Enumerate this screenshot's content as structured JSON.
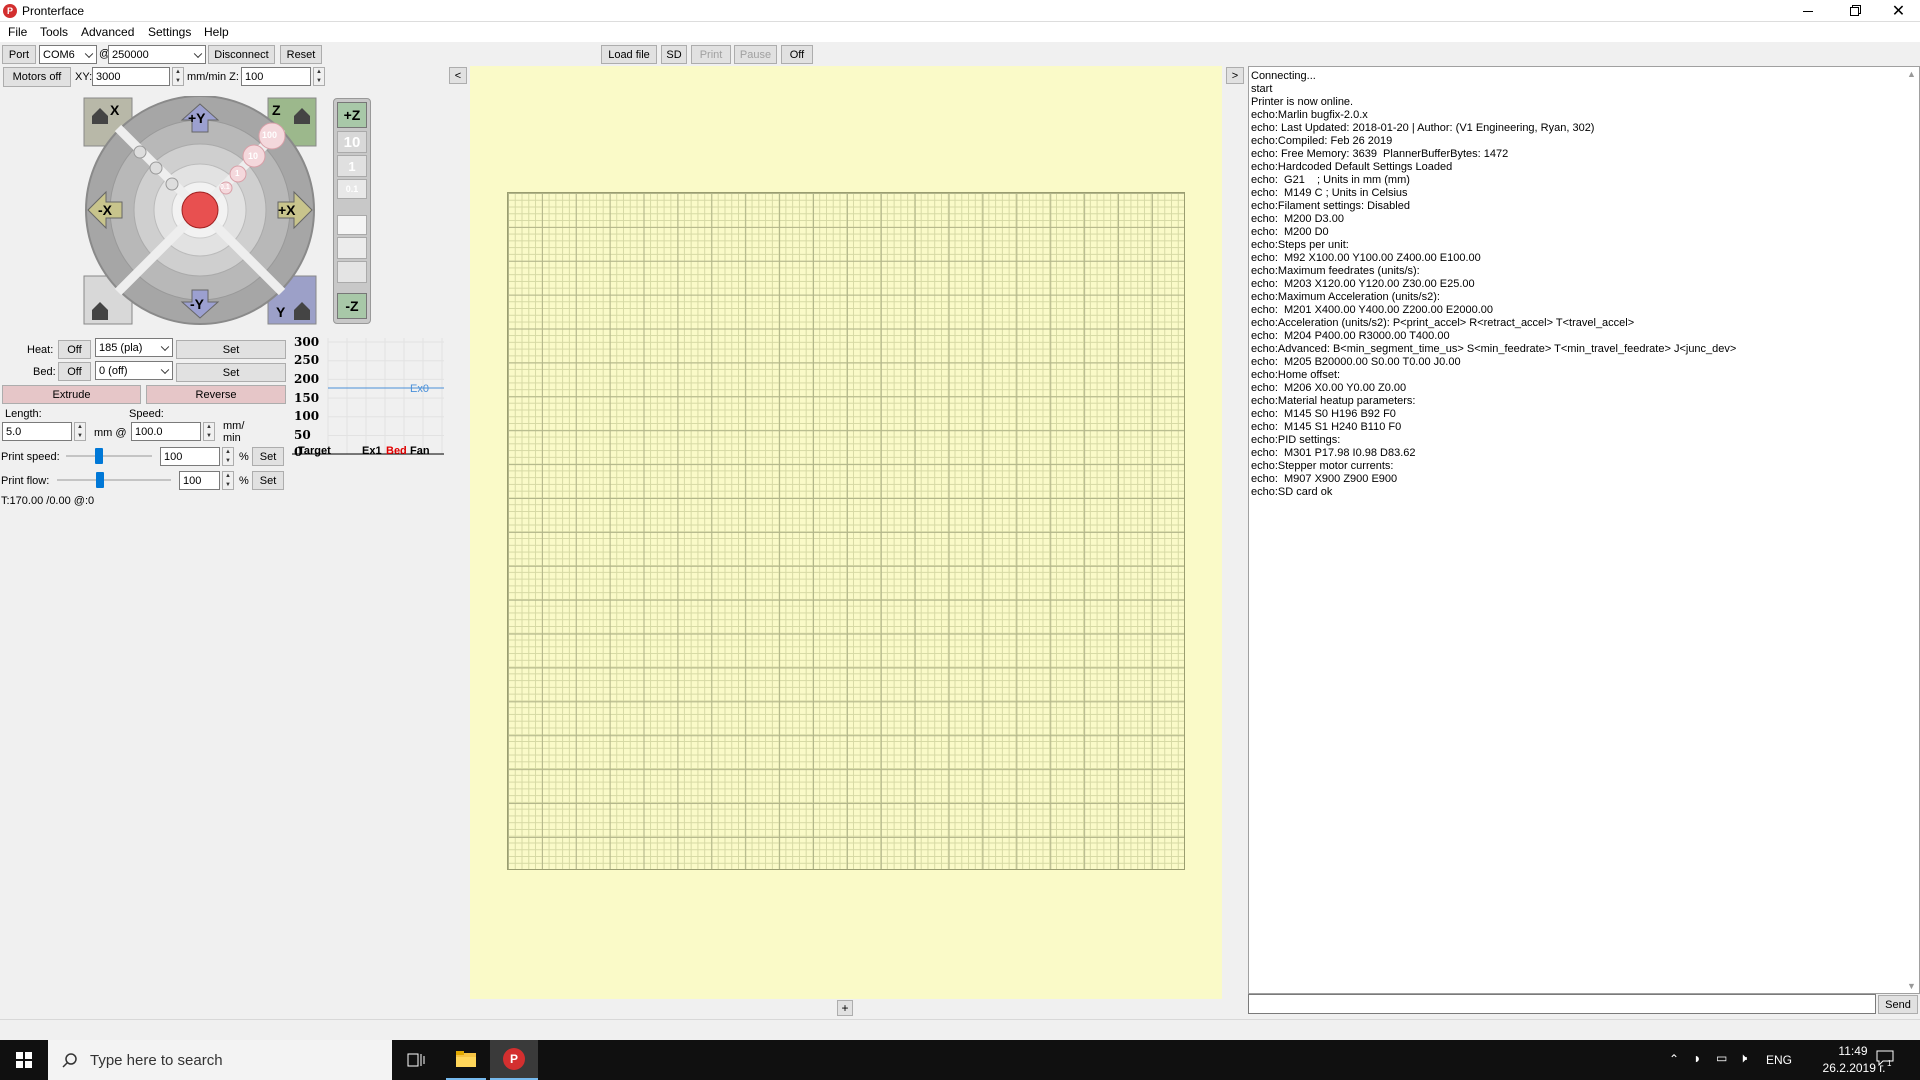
{
  "window": {
    "title": "Pronterface"
  },
  "menu": [
    "File",
    "Tools",
    "Advanced",
    "Settings",
    "Help"
  ],
  "toolbar": {
    "port_label": "Port",
    "port_value": "COM6",
    "at": "@",
    "baud_value": "250000",
    "disconnect": "Disconnect",
    "reset": "Reset",
    "load_file": "Load file",
    "sd": "SD",
    "print": "Print",
    "pause": "Pause",
    "off": "Off"
  },
  "motion": {
    "motors_off": "Motors off",
    "xy_label": "XY:",
    "xy_value": "3000",
    "units_label": "mm/min Z:",
    "z_value": "100"
  },
  "jog": {
    "home_x": "X",
    "home_z": "Z",
    "home_y": "Y",
    "plus_y": "+Y",
    "minus_y": "-Y",
    "plus_x": "+X",
    "minus_x": "-X",
    "plus_z": "+Z",
    "minus_z": "-Z",
    "step_100": "100",
    "step_10": "10",
    "step_1": "1",
    "step_01": "0.1",
    "z_10": "10",
    "z_1": "1",
    "z_01": "0.1"
  },
  "temps": {
    "heat_label": "Heat:",
    "heat_off": "Off",
    "heat_value": "185 (pla)",
    "heat_set": "Set",
    "bed_label": "Bed:",
    "bed_off": "Off",
    "bed_value": "0 (off)",
    "bed_set": "Set"
  },
  "extrude": {
    "extrude": "Extrude",
    "reverse": "Reverse",
    "length_label": "Length:",
    "length_value": "5.0",
    "mm_at": "mm @",
    "speed_label": "Speed:",
    "speed_value": "100.0",
    "rate_unit_1": "mm/",
    "rate_unit_2": "min"
  },
  "speeds": {
    "print_speed_label": "Print speed:",
    "print_speed_value": "100",
    "print_flow_label": "Print flow:",
    "print_flow_value": "100",
    "pct": "%",
    "set": "Set",
    "print_speed_level": 0.38,
    "print_flow_level": 0.38
  },
  "status_line": "T:170.00 /0.00 @:0",
  "graph": {
    "ticks": [
      "300",
      "250",
      "200",
      "150",
      "100",
      "50",
      "0"
    ],
    "ex0_label": "Ex0",
    "legend": [
      {
        "text": "Target",
        "color": "#000000"
      },
      {
        "text": "Ex1",
        "color": "#000000"
      },
      {
        "text": "Bed",
        "color": "#e00000"
      },
      {
        "text": "Fan",
        "color": "#000000"
      }
    ],
    "ex0_color": "#4a90d9"
  },
  "collapse_left": "<",
  "collapse_right": ">",
  "plus_button": "+",
  "console": {
    "lines": [
      "Connecting...",
      "start",
      "Printer is now online.",
      "echo:Marlin bugfix-2.0.x",
      "echo: Last Updated: 2018-01-20 | Author: (V1 Engineering, Ryan, 302)",
      "echo:Compiled: Feb 26 2019",
      "echo: Free Memory: 3639  PlannerBufferBytes: 1472",
      "echo:Hardcoded Default Settings Loaded",
      "echo:  G21    ; Units in mm (mm)",
      "echo:  M149 C ; Units in Celsius",
      "echo:Filament settings: Disabled",
      "echo:  M200 D3.00",
      "echo:  M200 D0",
      "echo:Steps per unit:",
      "echo:  M92 X100.00 Y100.00 Z400.00 E100.00",
      "echo:Maximum feedrates (units/s):",
      "echo:  M203 X120.00 Y120.00 Z30.00 E25.00",
      "echo:Maximum Acceleration (units/s2):",
      "echo:  M201 X400.00 Y400.00 Z200.00 E2000.00",
      "echo:Acceleration (units/s2): P<print_accel> R<retract_accel> T<travel_accel>",
      "echo:  M204 P400.00 R3000.00 T400.00",
      "echo:Advanced: B<min_segment_time_us> S<min_feedrate> T<min_travel_feedrate> J<junc_dev>",
      "echo:  M205 B20000.00 S0.00 T0.00 J0.00",
      "echo:Home offset:",
      "echo:  M206 X0.00 Y0.00 Z0.00",
      "echo:Material heatup parameters:",
      "echo:  M145 S0 H196 B92 F0",
      "echo:  M145 S1 H240 B110 F0",
      "echo:PID settings:",
      "echo:  M301 P17.98 I0.98 D83.62",
      "echo:Stepper motor currents:",
      "echo:  M907 X900 Z900 E900",
      "echo:SD card ok"
    ],
    "input_value": "",
    "send": "Send"
  },
  "taskbar": {
    "search_placeholder": "Type here to search",
    "lang": "ENG",
    "time": "11:49",
    "date": "26.2.2019 г.",
    "notif_count": "1"
  },
  "colors": {
    "plate_bg": "#fafac8",
    "taskbar_bg": "#101010",
    "titlebar_bg": "#ffffff"
  }
}
